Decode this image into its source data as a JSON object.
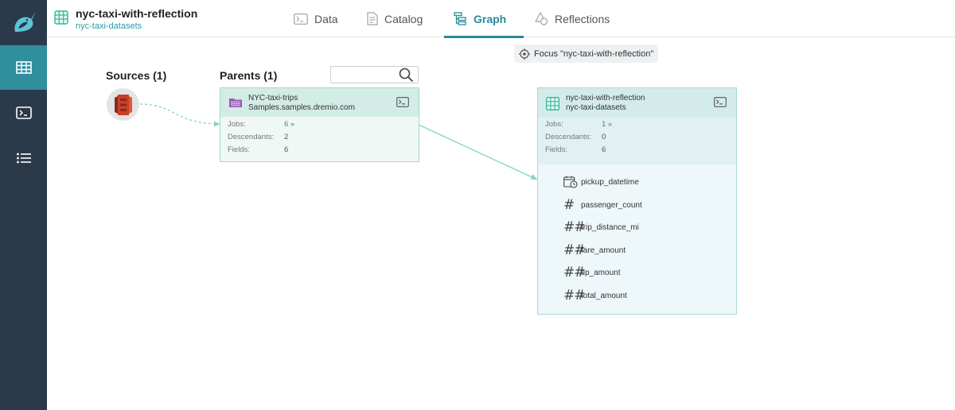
{
  "header": {
    "dataset_title": "nyc-taxi-with-reflection",
    "dataset_space": "nyc-taxi-datasets",
    "tabs": [
      {
        "label": "Data",
        "icon": "terminal-icon"
      },
      {
        "label": "Catalog",
        "icon": "document-icon"
      },
      {
        "label": "Graph",
        "icon": "graph-icon",
        "active": true
      },
      {
        "label": "Reflections",
        "icon": "reflections-icon"
      }
    ]
  },
  "sidebar": {
    "items": [
      {
        "name": "datasets",
        "icon": "grid-icon",
        "active": true
      },
      {
        "name": "sql-runner",
        "icon": "terminal-icon"
      },
      {
        "name": "jobs",
        "icon": "list-icon"
      }
    ]
  },
  "graph": {
    "focus_label": "Focus \"nyc-taxi-with-reflection\"",
    "sources_heading": "Sources (1)",
    "parents_heading": "Parents (1)",
    "search_placeholder": "",
    "source_icon": "amazon-s3-icon",
    "parent": {
      "name": "NYC-taxi-trips",
      "path": "Samples.samples.dremio.com",
      "icon": "folder-icon",
      "jobs_label": "Jobs:",
      "jobs_value": "6 »",
      "descendants_label": "Descendants:",
      "descendants_value": "2",
      "fields_label": "Fields:",
      "fields_value": "6"
    },
    "current": {
      "name": "nyc-taxi-with-reflection",
      "path": "nyc-taxi-datasets",
      "icon": "dataset-grid-icon",
      "jobs_label": "Jobs:",
      "jobs_value": "1 »",
      "descendants_label": "Descendants:",
      "descendants_value": "0",
      "fields_label": "Fields:",
      "fields_value": "6",
      "fields": [
        {
          "name": "pickup_datetime",
          "type": "datetime"
        },
        {
          "name": "passenger_count",
          "type": "integer"
        },
        {
          "name": "trip_distance_mi",
          "type": "double"
        },
        {
          "name": "fare_amount",
          "type": "double"
        },
        {
          "name": "tip_amount",
          "type": "double"
        },
        {
          "name": "total_amount",
          "type": "double"
        }
      ]
    }
  },
  "colors": {
    "sidebar": "#2b3a4b",
    "accent": "#2a8a97",
    "edge": "#7fd6c4",
    "folder": "#9b59b6",
    "s3": "#d9472b"
  }
}
